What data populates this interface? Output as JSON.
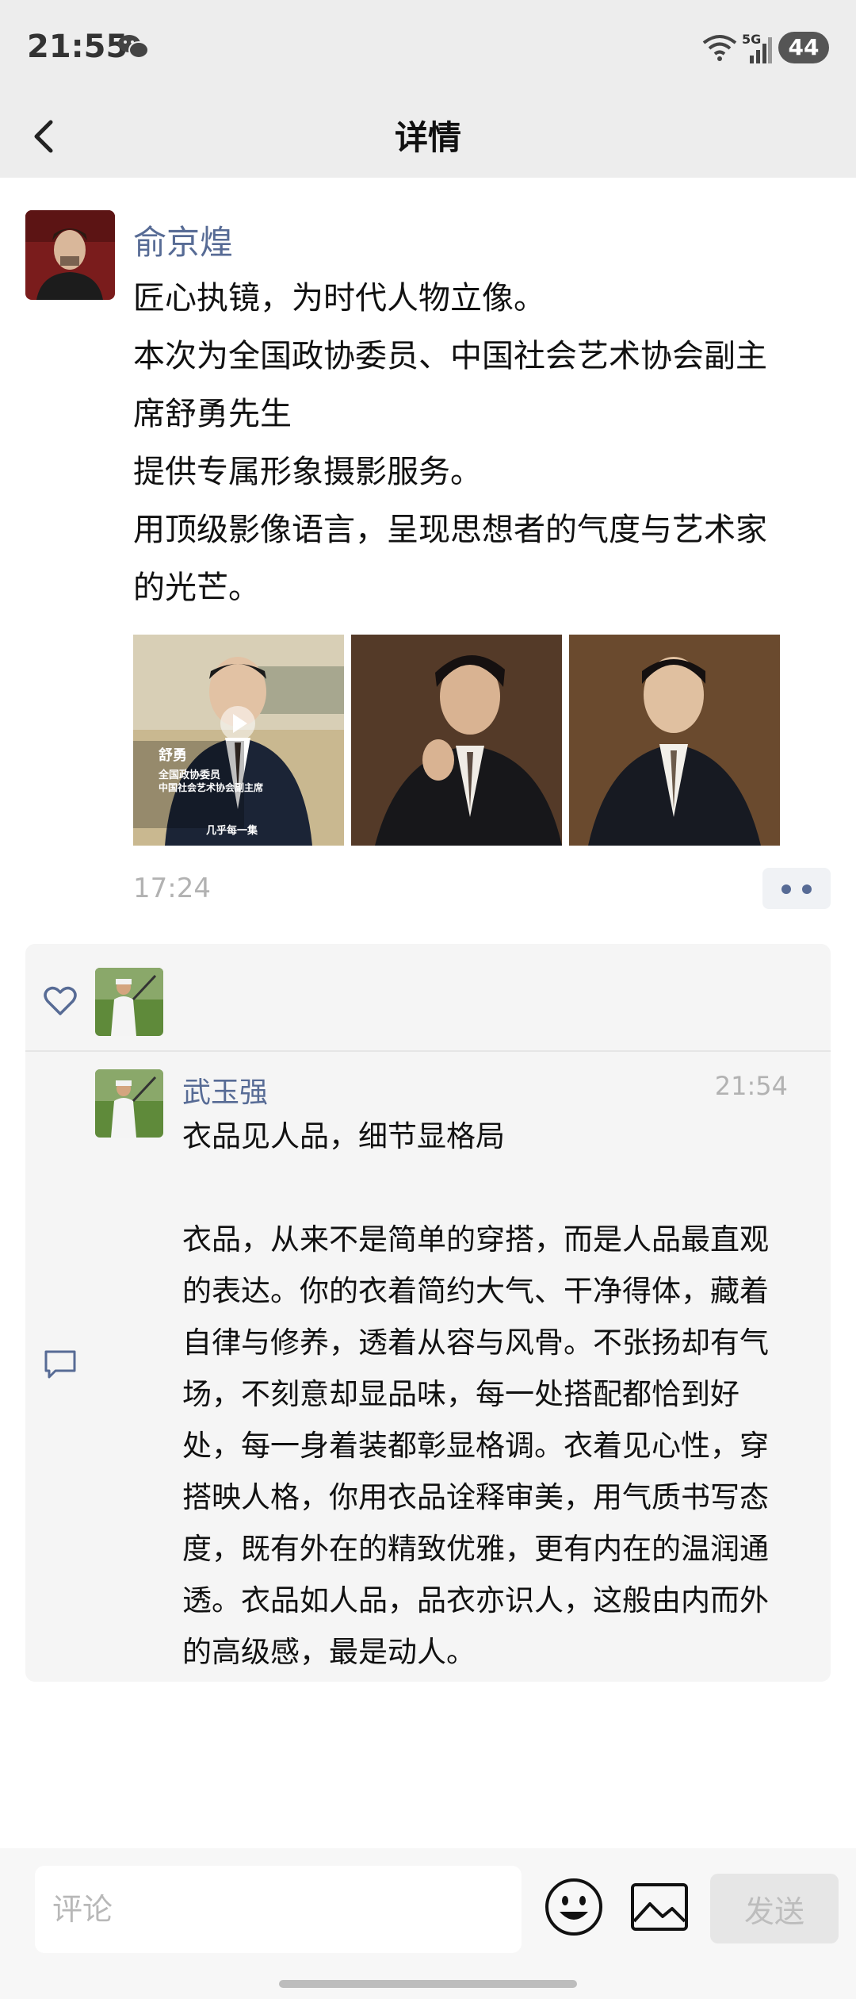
{
  "status_bar": {
    "time": "21:55",
    "network": "5G",
    "battery": "44"
  },
  "nav": {
    "title": "详情"
  },
  "post": {
    "author": "俞京煌",
    "body_lines": [
      "匠心执镜，为时代人物立像。",
      "本次为全国政协委员、中国社会艺术协会副主",
      "席舒勇先生",
      "提供专属形象摄影服务。",
      "用顶级影像语言，呈现思想者的气度与艺术家",
      "的光芒。"
    ],
    "photos": [
      {
        "icon": "video-thumbnail",
        "caption_name": "舒勇",
        "caption_line1": "全国政协委员",
        "caption_line2": "中国社会艺术协会副主席",
        "caption_footer": "几乎每一集"
      },
      {
        "icon": "portrait-photo"
      },
      {
        "icon": "portrait-photo"
      }
    ],
    "time": "17:24"
  },
  "comments": {
    "likes": [
      {
        "icon": "golfer-avatar"
      }
    ],
    "items": [
      {
        "name": "武玉强",
        "time": "21:54",
        "lines": [
          "衣品见人品，细节显格局",
          "",
          "衣品，从来不是简单的穿搭，而是人品最直观",
          "的表达。你的衣着简约大气、干净得体，藏着",
          "自律与修养，透着从容与风骨。不张扬却有气",
          "场，不刻意却显品味，每一处搭配都恰到好",
          "处，每一身着装都彰显格调。衣着见心性，穿",
          "搭映人格，你用衣品诠释审美，用气质书写态",
          "度，既有外在的精致优雅，更有内在的温润通",
          "透。衣品如人品，品衣亦识人，这般由内而外",
          "的高级感，最是动人。"
        ]
      }
    ]
  },
  "input_bar": {
    "placeholder": "评论",
    "send_label": "发送"
  },
  "colors": {
    "link_blue": "#576b95",
    "header_gray": "#ededed",
    "muted_gray": "#b2b2b2"
  }
}
